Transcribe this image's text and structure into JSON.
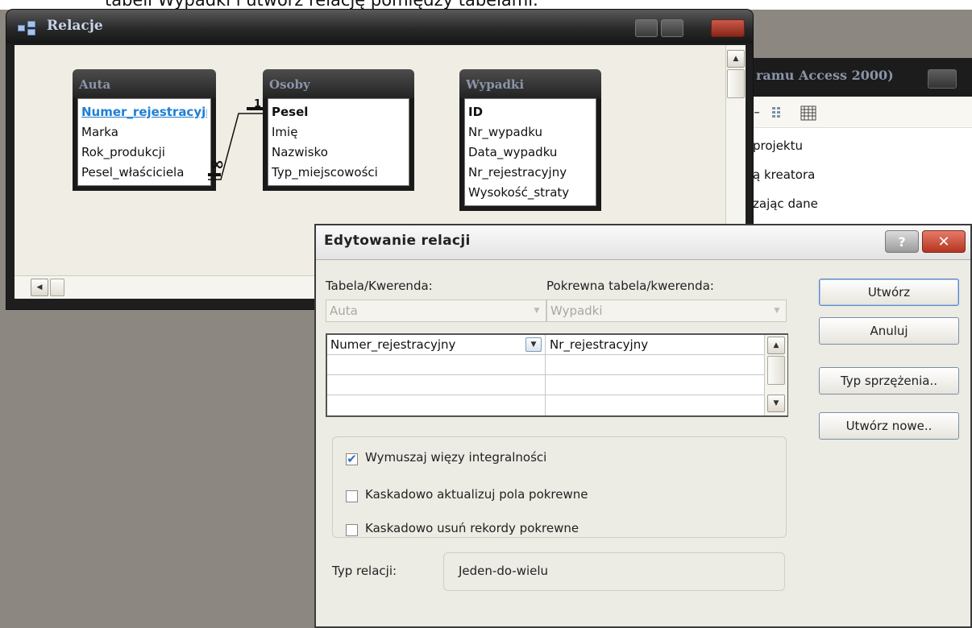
{
  "caption": {
    "text": "tabeli Wypadki i utwórz relację pomiędzy tabelami."
  },
  "relations_window": {
    "title": "Relacje",
    "tables": [
      {
        "name": "Auta",
        "fields": [
          "Numer_rejestracyjny",
          "Marka",
          "Rok_produkcji",
          "Pesel_właściciela"
        ]
      },
      {
        "name": "Osoby",
        "fields": [
          "Pesel",
          "Imię",
          "Nazwisko",
          "Typ_miejscowości"
        ]
      },
      {
        "name": "Wypadki",
        "fields": [
          "ID",
          "Nr_wypadku",
          "Data_wypadku",
          "Nr_rejestracyjny",
          "Wysokość_straty"
        ]
      }
    ],
    "relationship": {
      "one_label": "1",
      "many_label": "∞"
    }
  },
  "task_pane": {
    "title": "ramu Access 2000)",
    "items": [
      "projektu",
      "ą kreatora",
      "zając dane"
    ]
  },
  "dialog": {
    "title": "Edytowanie relacji",
    "help_label": "?",
    "close_label": "✕",
    "table_label": "Tabela/Kwerenda:",
    "related_label": "Pokrewna tabela/kwerenda:",
    "table_value": "Auta",
    "related_value": "Wypadki",
    "grid_rows": [
      {
        "field": "Numer_rejestracyjny",
        "related": "Nr_rejestracyjny"
      },
      {
        "field": "",
        "related": ""
      },
      {
        "field": "",
        "related": ""
      },
      {
        "field": "",
        "related": ""
      }
    ],
    "options": [
      {
        "label": "Wymuszaj więzy integralności",
        "checked": true
      },
      {
        "label": "Kaskadowo aktualizuj pola pokrewne",
        "checked": false
      },
      {
        "label": "Kaskadowo usuń rekordy pokrewne",
        "checked": false
      }
    ],
    "relation_type_label": "Typ relacji:",
    "relation_type_value": "Jeden-do-wielu",
    "buttons": {
      "create": "Utwórz",
      "cancel": "Anuluj",
      "join_type": "Typ sprzężenia..",
      "create_new": "Utwórz nowe.."
    }
  }
}
